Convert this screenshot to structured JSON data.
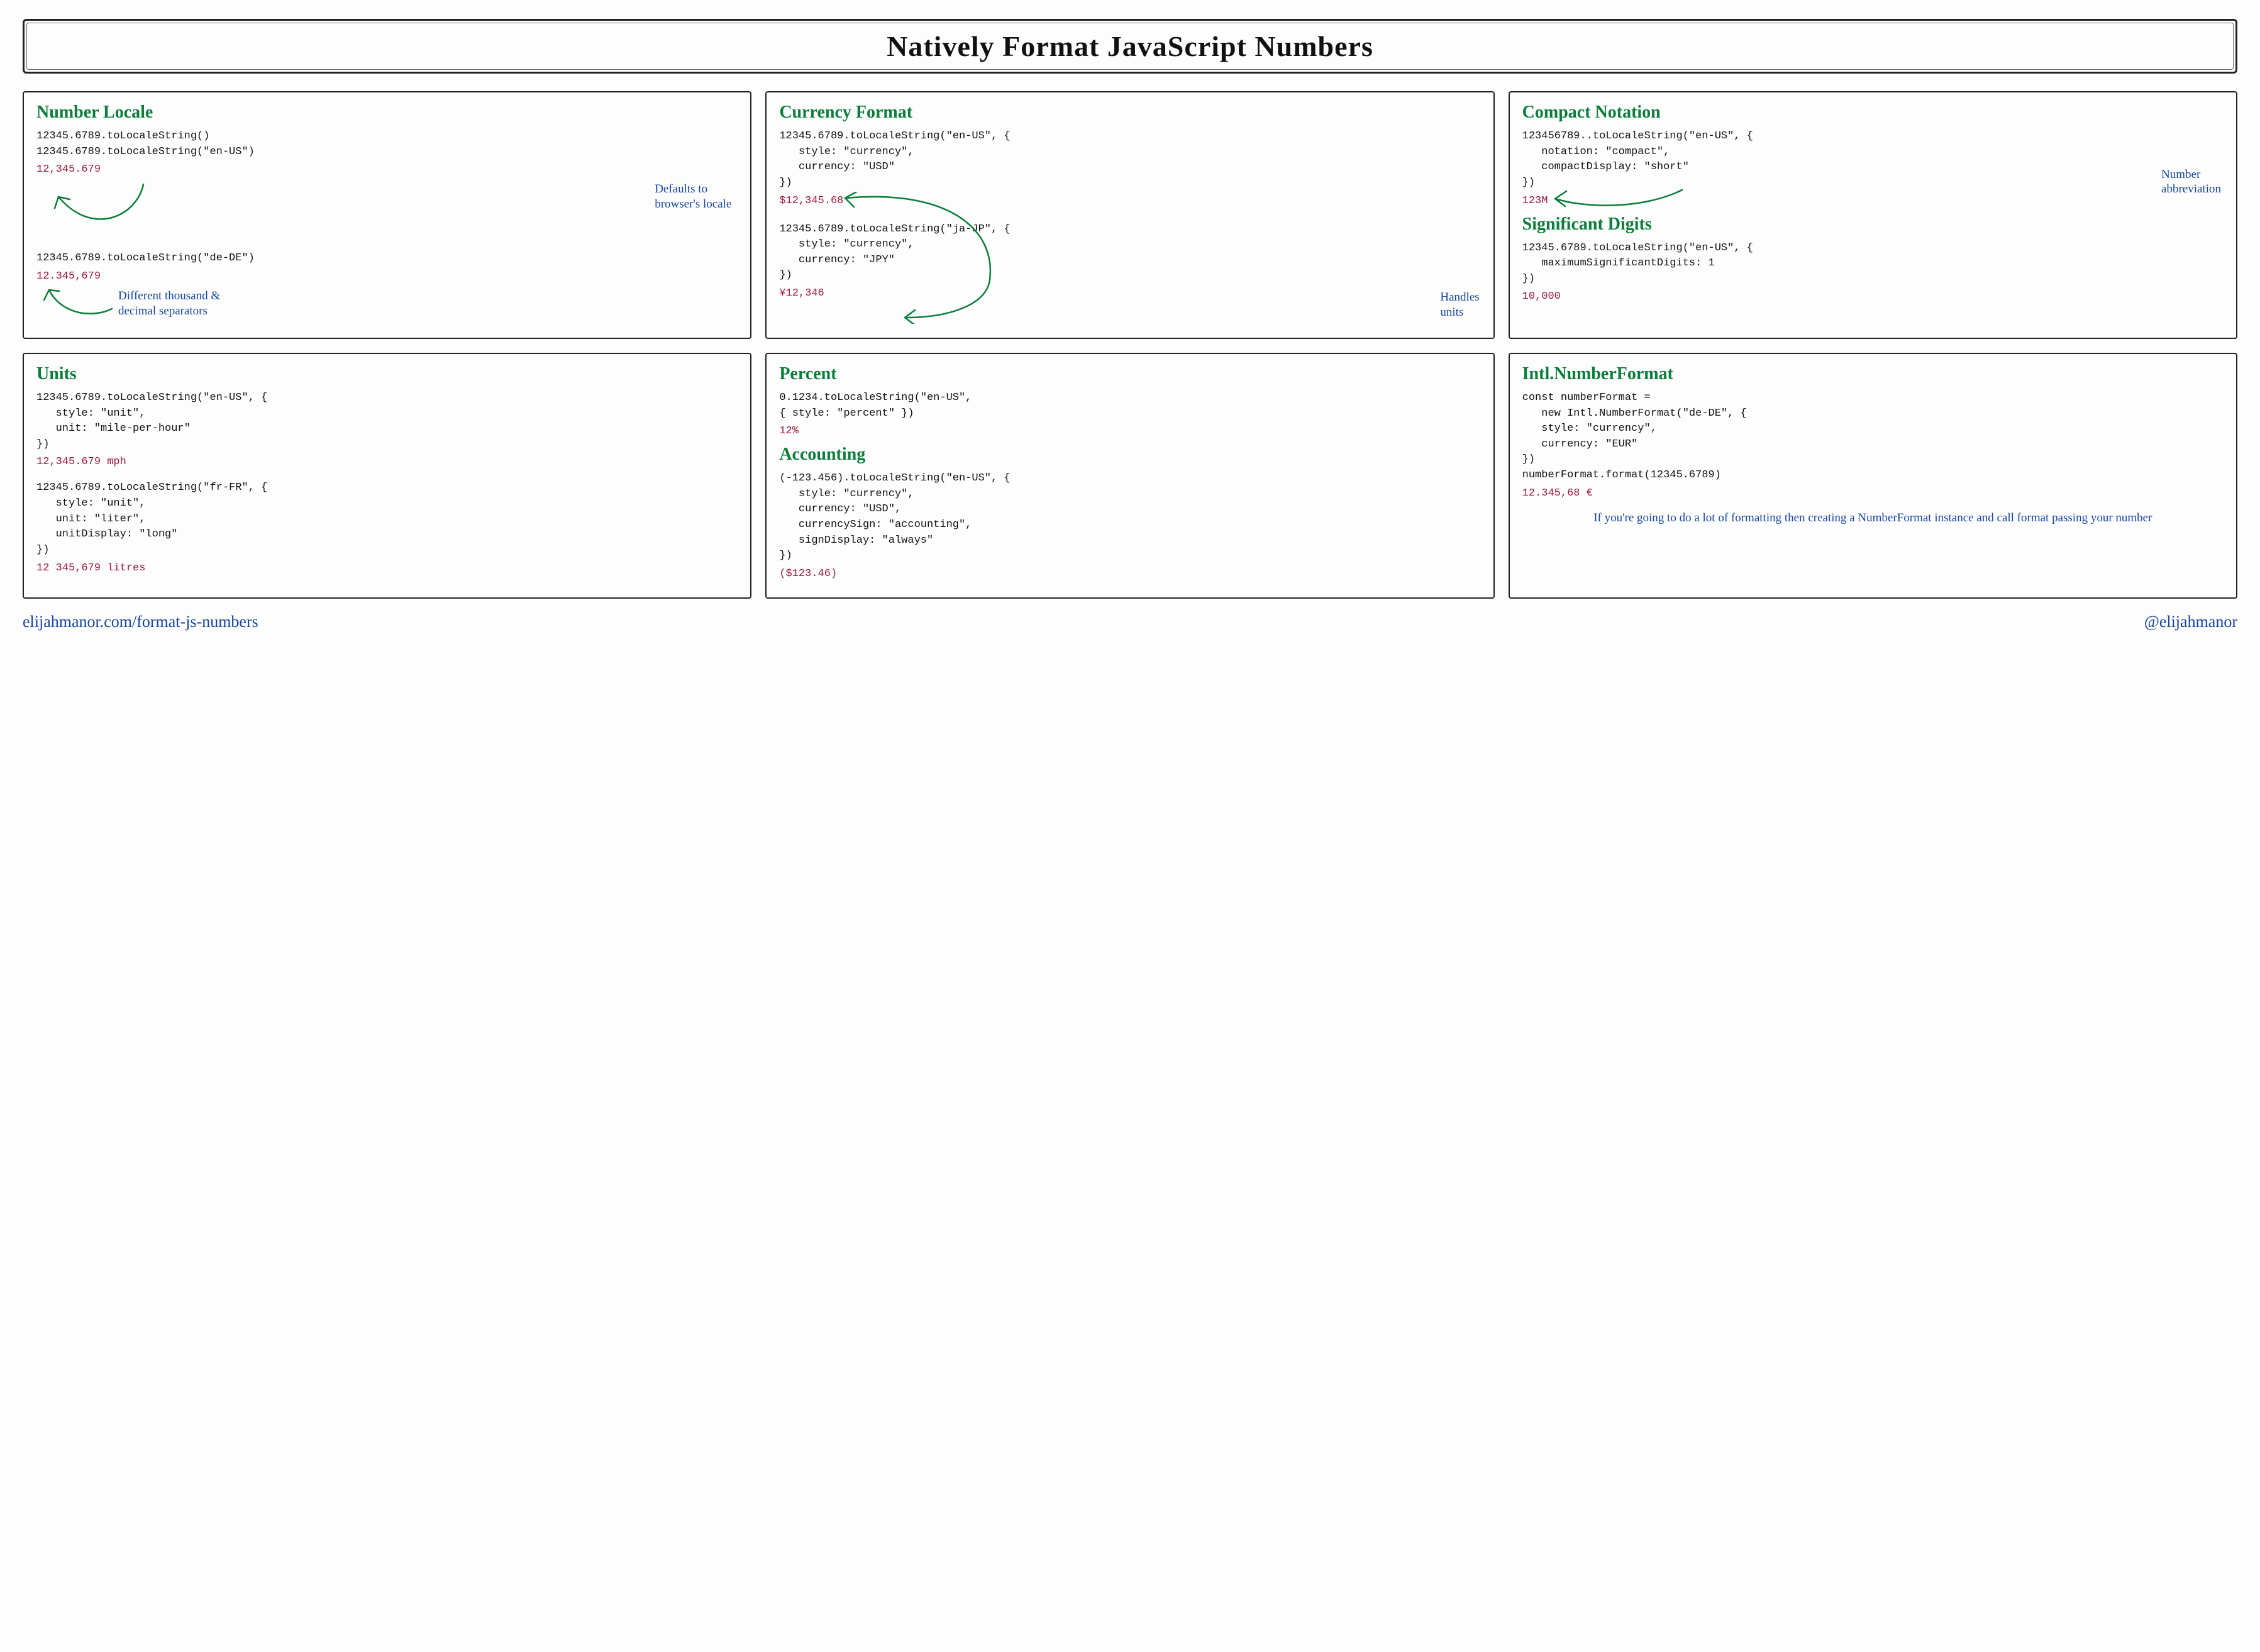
{
  "title": "Natively Format JavaScript Numbers",
  "cards": {
    "locale": {
      "heading": "Number Locale",
      "code1": "12345.6789.toLocaleString()\n12345.6789.toLocaleString(\"en-US\")",
      "result1": "12,345.679",
      "annot1": "Defaults to\nbrowser's locale",
      "code2": "12345.6789.toLocaleString(\"de-DE\")",
      "result2": "12.345,679",
      "annot2": "Different thousand &\ndecimal separators"
    },
    "currency": {
      "heading": "Currency Format",
      "code1": "12345.6789.toLocaleString(\"en-US\", {\n   style: \"currency\",\n   currency: \"USD\"\n})",
      "result1": "$12,345.68",
      "code2": "12345.6789.toLocaleString(\"ja-JP\", {\n   style: \"currency\",\n   currency: \"JPY\"\n})",
      "result2": "¥12,346",
      "annot": "Handles\nunits"
    },
    "compact": {
      "heading": "Compact Notation",
      "code1": "123456789..toLocaleString(\"en-US\", {\n   notation: \"compact\",\n   compactDisplay: \"short\"\n})",
      "result1": "123M",
      "annot1": "Number\nabbreviation",
      "heading2": "Significant Digits",
      "code2": "12345.6789.toLocaleString(\"en-US\", {\n   maximumSignificantDigits: 1\n})",
      "result2": "10,000"
    },
    "units": {
      "heading": "Units",
      "code1": "12345.6789.toLocaleString(\"en-US\", {\n   style: \"unit\",\n   unit: \"mile-per-hour\"\n})",
      "result1": "12,345.679 mph",
      "code2": "12345.6789.toLocaleString(\"fr-FR\", {\n   style: \"unit\",\n   unit: \"liter\",\n   unitDisplay: \"long\"\n})",
      "result2": "12 345,679 litres"
    },
    "percent": {
      "heading": "Percent",
      "code1": "0.1234.toLocaleString(\"en-US\",\n{ style: \"percent\" })",
      "result1": "12%",
      "heading2": "Accounting",
      "code2": "(-123.456).toLocaleString(\"en-US\", {\n   style: \"currency\",\n   currency: \"USD\",\n   currencySign: \"accounting\",\n   signDisplay: \"always\"\n})",
      "result2": "($123.46)"
    },
    "intl": {
      "heading": "Intl.NumberFormat",
      "code1": "const numberFormat =\n   new Intl.NumberFormat(\"de-DE\", {\n   style: \"currency\",\n   currency: \"EUR\"\n})\nnumberFormat.format(12345.6789)",
      "result1": "12.345,68 €",
      "annot": "If you're going to do a lot of formatting then creating a NumberFormat instance and call format passing your number"
    }
  },
  "footer": {
    "left": "elijahmanor.com/format-js-numbers",
    "right": "@elijahmanor"
  }
}
